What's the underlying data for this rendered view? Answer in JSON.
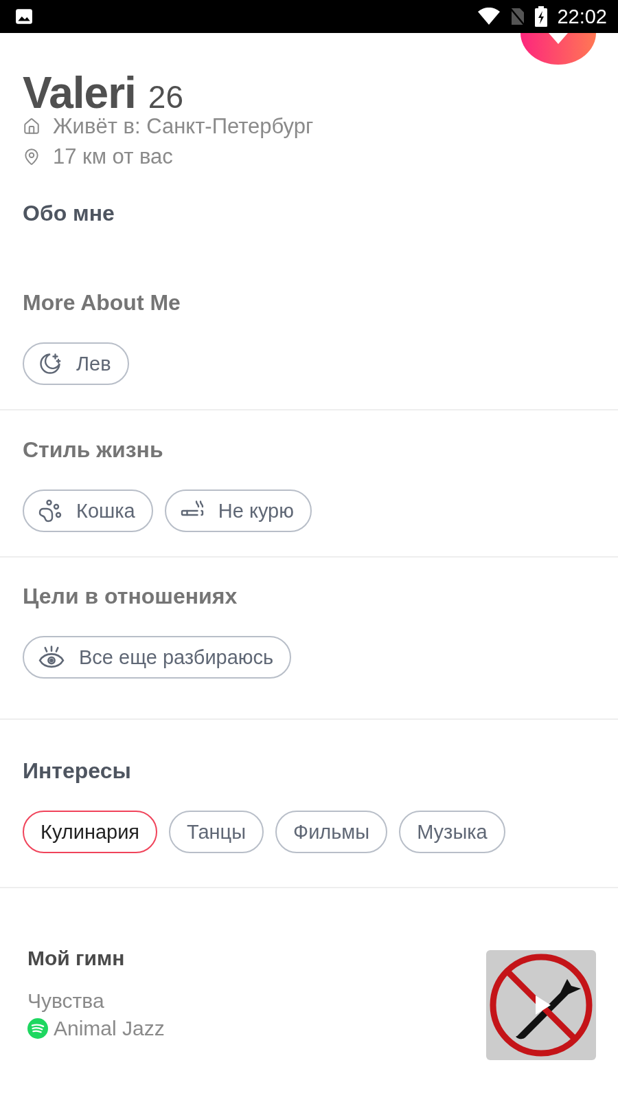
{
  "status_bar": {
    "time": "22:02"
  },
  "profile": {
    "name": "Valeri",
    "age": "26",
    "lives_in": "Живёт в: Санкт-Петербург",
    "distance": "17 км от вас"
  },
  "about": {
    "heading": "Обо мне"
  },
  "sections": [
    {
      "heading": "More About Me",
      "chips": [
        {
          "kind": "zodiac",
          "label": "Лев"
        }
      ]
    },
    {
      "heading": "Стиль жизнь",
      "chips": [
        {
          "kind": "pet",
          "label": "Кошка"
        },
        {
          "kind": "smoking",
          "label": "Не курю"
        }
      ]
    },
    {
      "heading": "Цели в отношениях",
      "chips": [
        {
          "kind": "goal",
          "label": "Все еще разбираюсь"
        }
      ]
    }
  ],
  "interests": {
    "heading": "Интересы",
    "items": [
      {
        "label": "Кулинария",
        "shared": true
      },
      {
        "label": "Танцы",
        "shared": false
      },
      {
        "label": "Фильмы",
        "shared": false
      },
      {
        "label": "Музыка",
        "shared": false
      }
    ]
  },
  "anthem": {
    "heading": "Мой гимн",
    "song": "Чувства",
    "artist": "Animal Jazz"
  }
}
